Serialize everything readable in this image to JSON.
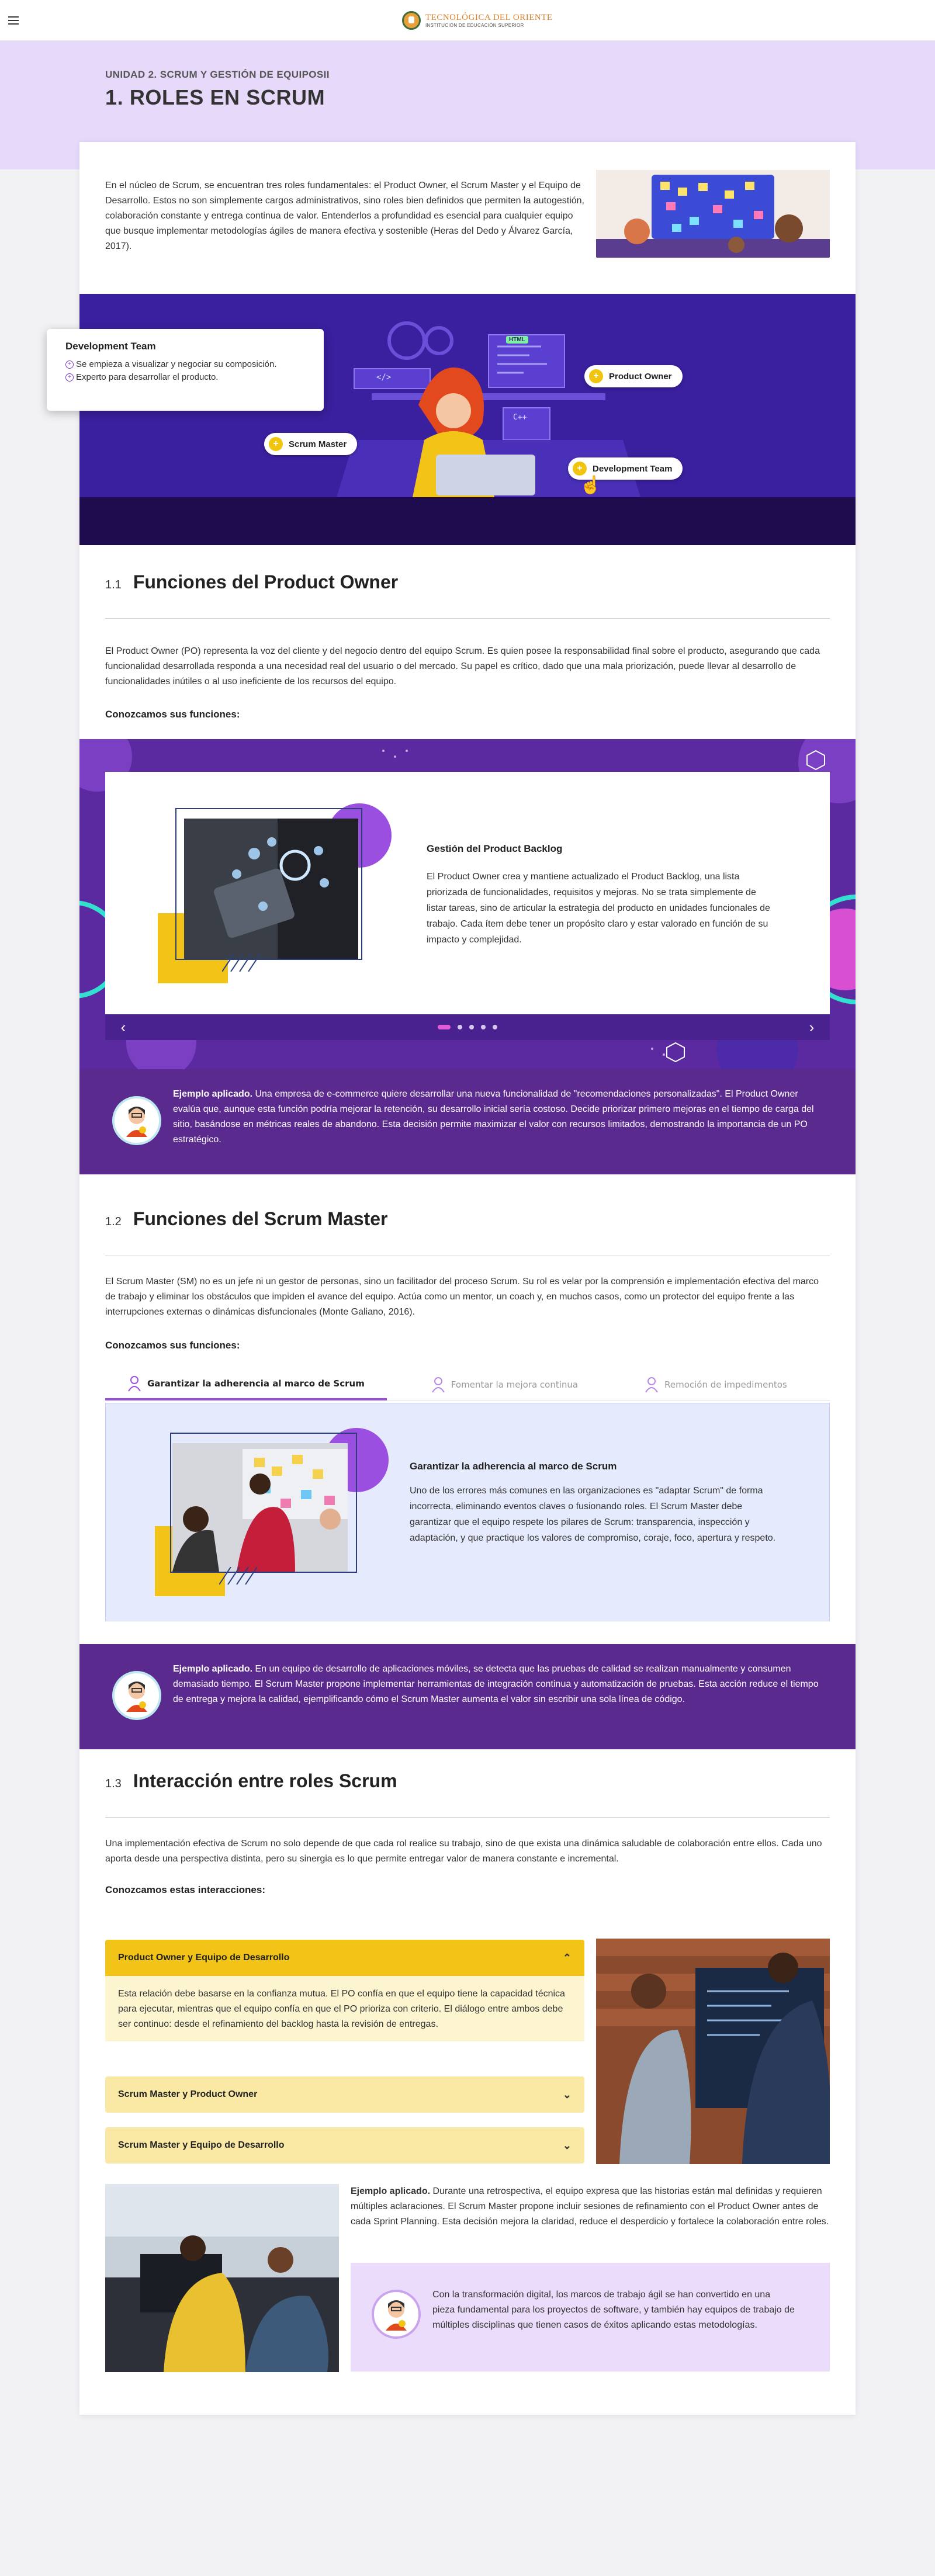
{
  "header": {
    "logo_name": "TECNOLÓGICA DEL ORIENTE",
    "logo_sub": "INSTITUCIÓN DE EDUCACIÓN SUPERIOR"
  },
  "banner": {
    "unit": "UNIDAD 2. SCRUM Y GESTIÓN DE EQUIPOSII",
    "title": "1. ROLES EN SCRUM"
  },
  "intro": {
    "text": "En el núcleo de Scrum, se encuentran tres roles fundamentales: el Product Owner, el Scrum Master y el Equipo de Desarrollo. Estos no son simplemente cargos administrativos, sino roles bien definidos que permiten la autogestión, colaboración constante y entrega continua de valor. Entenderlos a profundidad es esencial para cualquier equipo que busque implementar metodologías ágiles de manera efectiva y sostenible (Heras del Dedo y Álvarez García, 2017)."
  },
  "hero": {
    "code_tag": "</>",
    "html_tag": "HTML",
    "cpp_tag": "C++",
    "tags": [
      {
        "label": "Product Owner"
      },
      {
        "label": "Scrum Master"
      },
      {
        "label": "Development Team"
      }
    ],
    "popup": {
      "title": "Development Team",
      "items": [
        "Se empieza a visualizar y negociar su composición.",
        "Experto para desarrollar el producto."
      ]
    }
  },
  "section1": {
    "num": "1.1",
    "title": "Funciones del Product Owner",
    "text": "El Product Owner (PO) representa la voz del cliente y del negocio dentro del equipo Scrum. Es quien posee la responsabilidad final sobre el producto, asegurando que cada funcionalidad desarrollada responda a una necesidad real del usuario o del mercado. Su papel es crítico, dado que una mala priorización, puede llevar al desarrollo de funcionalidades inútiles o al uso ineficiente de los recursos del equipo.",
    "subhead": "Conozcamos sus funciones:",
    "slide": {
      "title": "Gestión del Product Backlog",
      "text": "El Product Owner crea y mantiene actualizado el Product Backlog, una lista priorizada de funcionalidades, requisitos y mejoras. No se trata simplemente de listar tareas, sino de articular la estrategia del producto en unidades funcionales de trabajo. Cada ítem debe tener un propósito claro y estar valorado en función de su impacto y complejidad."
    },
    "slide_count": 5,
    "active_slide": 1,
    "example_label": "Ejemplo aplicado.",
    "example_text": " Una empresa de e-commerce quiere desarrollar una nueva funcionalidad de \"recomendaciones personalizadas\". El Product Owner evalúa que, aunque esta función podría mejorar la retención, su desarrollo inicial sería costoso. Decide priorizar primero mejoras en el tiempo de carga del sitio, basándose en métricas reales de abandono. Esta decisión permite maximizar el valor con recursos limitados, demostrando la importancia de un PO estratégico."
  },
  "section2": {
    "num": "1.2",
    "title": "Funciones del Scrum Master",
    "text": "El Scrum Master (SM) no es un jefe ni un gestor de personas, sino un facilitador del proceso Scrum. Su rol es velar por la comprensión e implementación efectiva del marco de trabajo y eliminar los obstáculos que impiden el avance del equipo. Actúa como un mentor, un coach y, en muchos casos, como un protector del equipo frente a las interrupciones externas o dinámicas disfuncionales (Monte Galiano, 2016).",
    "subhead": "Conozcamos sus funciones:",
    "tabs": [
      {
        "label": "Garantizar la adherencia al marco de Scrum"
      },
      {
        "label": "Fomentar la mejora continua"
      },
      {
        "label": "Remoción de impedimentos"
      }
    ],
    "panel": {
      "title": "Garantizar la adherencia al marco de Scrum",
      "text": "Uno de los errores más comunes en las organizaciones es \"adaptar Scrum\" de forma incorrecta, eliminando eventos claves o fusionando roles. El Scrum Master debe garantizar que el equipo respete los pilares de Scrum: transparencia, inspección y adaptación, y que practique los valores de compromiso, coraje, foco, apertura y respeto."
    },
    "example_label": "Ejemplo aplicado.",
    "example_text": " En un equipo de desarrollo de aplicaciones móviles, se detecta que las pruebas de calidad se realizan manualmente y consumen demasiado tiempo. El Scrum Master propone implementar herramientas de integración continua y automatización de pruebas. Esta acción reduce el tiempo de entrega y mejora la calidad, ejemplificando cómo el Scrum Master aumenta el valor sin escribir una sola línea de código."
  },
  "section3": {
    "num": "1.3",
    "title": "Interacción entre roles Scrum",
    "text": "Una implementación efectiva de Scrum no solo depende de que cada rol realice su trabajo, sino de que exista una dinámica saludable de colaboración entre ellos. Cada uno aporta desde una perspectiva distinta, pero su sinergia es lo que permite entregar valor de manera constante e incremental.",
    "subhead": "Conozcamos estas interacciones:",
    "accordion": [
      {
        "label": "Product Owner y Equipo de Desarrollo",
        "text": "Esta relación debe basarse en la confianza mutua. El PO confía en que el equipo tiene la capacidad técnica para ejecutar, mientras que el equipo confía en que el PO prioriza con criterio. El diálogo entre ambos debe ser continuo: desde el refinamiento del backlog hasta la revisión de entregas."
      },
      {
        "label": "Scrum Master y Product Owner"
      },
      {
        "label": "Scrum Master y Equipo de Desarrollo"
      }
    ],
    "example_label": "Ejemplo aplicado.",
    "example_text": " Durante una retrospectiva, el equipo expresa que las historias están mal definidas y requieren múltiples aclaraciones. El Scrum Master propone incluir sesiones de refinamiento con el Product Owner antes de cada Sprint Planning. Esta decisión mejora la claridad, reduce el desperdicio y fortalece la colaboración entre roles.",
    "note": "Con la transformación digital, los marcos de trabajo ágil se han convertido en una pieza fundamental para los proyectos de software, y también hay equipos de trabajo de múltiples disciplinas que tienen casos de éxitos aplicando estas metodologías."
  },
  "colors": {
    "purple_dark": "#5b2a8f",
    "purple_light": "#e6d9fa",
    "yellow": "#f2c417",
    "hero_blue": "#3a1f9e"
  },
  "icons": [
    "menu-icon",
    "chevron-up-icon",
    "chevron-down-icon",
    "arrow-left-icon",
    "arrow-right-icon",
    "person-icon"
  ]
}
